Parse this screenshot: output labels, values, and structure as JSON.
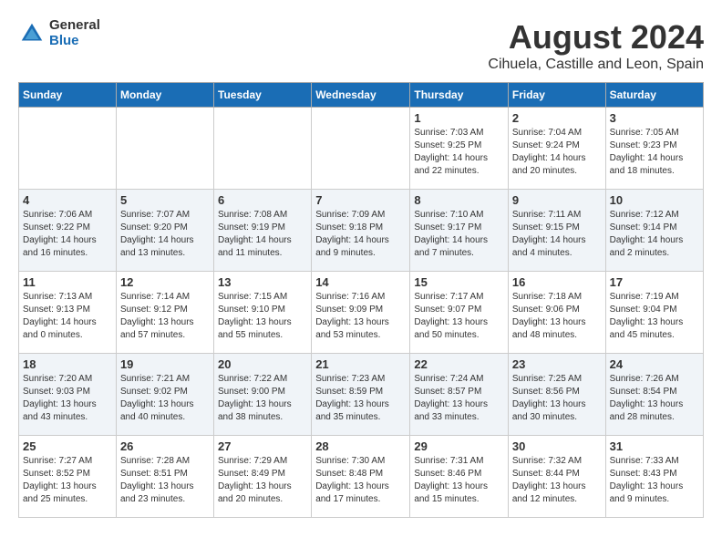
{
  "header": {
    "logo": {
      "general": "General",
      "blue": "Blue"
    },
    "title": "August 2024",
    "subtitle": "Cihuela, Castille and Leon, Spain"
  },
  "weekdays": [
    "Sunday",
    "Monday",
    "Tuesday",
    "Wednesday",
    "Thursday",
    "Friday",
    "Saturday"
  ],
  "weeks": [
    [
      {
        "day": "",
        "sunrise": "",
        "sunset": "",
        "daylight": ""
      },
      {
        "day": "",
        "sunrise": "",
        "sunset": "",
        "daylight": ""
      },
      {
        "day": "",
        "sunrise": "",
        "sunset": "",
        "daylight": ""
      },
      {
        "day": "",
        "sunrise": "",
        "sunset": "",
        "daylight": ""
      },
      {
        "day": "1",
        "sunrise": "Sunrise: 7:03 AM",
        "sunset": "Sunset: 9:25 PM",
        "daylight": "Daylight: 14 hours and 22 minutes."
      },
      {
        "day": "2",
        "sunrise": "Sunrise: 7:04 AM",
        "sunset": "Sunset: 9:24 PM",
        "daylight": "Daylight: 14 hours and 20 minutes."
      },
      {
        "day": "3",
        "sunrise": "Sunrise: 7:05 AM",
        "sunset": "Sunset: 9:23 PM",
        "daylight": "Daylight: 14 hours and 18 minutes."
      }
    ],
    [
      {
        "day": "4",
        "sunrise": "Sunrise: 7:06 AM",
        "sunset": "Sunset: 9:22 PM",
        "daylight": "Daylight: 14 hours and 16 minutes."
      },
      {
        "day": "5",
        "sunrise": "Sunrise: 7:07 AM",
        "sunset": "Sunset: 9:20 PM",
        "daylight": "Daylight: 14 hours and 13 minutes."
      },
      {
        "day": "6",
        "sunrise": "Sunrise: 7:08 AM",
        "sunset": "Sunset: 9:19 PM",
        "daylight": "Daylight: 14 hours and 11 minutes."
      },
      {
        "day": "7",
        "sunrise": "Sunrise: 7:09 AM",
        "sunset": "Sunset: 9:18 PM",
        "daylight": "Daylight: 14 hours and 9 minutes."
      },
      {
        "day": "8",
        "sunrise": "Sunrise: 7:10 AM",
        "sunset": "Sunset: 9:17 PM",
        "daylight": "Daylight: 14 hours and 7 minutes."
      },
      {
        "day": "9",
        "sunrise": "Sunrise: 7:11 AM",
        "sunset": "Sunset: 9:15 PM",
        "daylight": "Daylight: 14 hours and 4 minutes."
      },
      {
        "day": "10",
        "sunrise": "Sunrise: 7:12 AM",
        "sunset": "Sunset: 9:14 PM",
        "daylight": "Daylight: 14 hours and 2 minutes."
      }
    ],
    [
      {
        "day": "11",
        "sunrise": "Sunrise: 7:13 AM",
        "sunset": "Sunset: 9:13 PM",
        "daylight": "Daylight: 14 hours and 0 minutes."
      },
      {
        "day": "12",
        "sunrise": "Sunrise: 7:14 AM",
        "sunset": "Sunset: 9:12 PM",
        "daylight": "Daylight: 13 hours and 57 minutes."
      },
      {
        "day": "13",
        "sunrise": "Sunrise: 7:15 AM",
        "sunset": "Sunset: 9:10 PM",
        "daylight": "Daylight: 13 hours and 55 minutes."
      },
      {
        "day": "14",
        "sunrise": "Sunrise: 7:16 AM",
        "sunset": "Sunset: 9:09 PM",
        "daylight": "Daylight: 13 hours and 53 minutes."
      },
      {
        "day": "15",
        "sunrise": "Sunrise: 7:17 AM",
        "sunset": "Sunset: 9:07 PM",
        "daylight": "Daylight: 13 hours and 50 minutes."
      },
      {
        "day": "16",
        "sunrise": "Sunrise: 7:18 AM",
        "sunset": "Sunset: 9:06 PM",
        "daylight": "Daylight: 13 hours and 48 minutes."
      },
      {
        "day": "17",
        "sunrise": "Sunrise: 7:19 AM",
        "sunset": "Sunset: 9:04 PM",
        "daylight": "Daylight: 13 hours and 45 minutes."
      }
    ],
    [
      {
        "day": "18",
        "sunrise": "Sunrise: 7:20 AM",
        "sunset": "Sunset: 9:03 PM",
        "daylight": "Daylight: 13 hours and 43 minutes."
      },
      {
        "day": "19",
        "sunrise": "Sunrise: 7:21 AM",
        "sunset": "Sunset: 9:02 PM",
        "daylight": "Daylight: 13 hours and 40 minutes."
      },
      {
        "day": "20",
        "sunrise": "Sunrise: 7:22 AM",
        "sunset": "Sunset: 9:00 PM",
        "daylight": "Daylight: 13 hours and 38 minutes."
      },
      {
        "day": "21",
        "sunrise": "Sunrise: 7:23 AM",
        "sunset": "Sunset: 8:59 PM",
        "daylight": "Daylight: 13 hours and 35 minutes."
      },
      {
        "day": "22",
        "sunrise": "Sunrise: 7:24 AM",
        "sunset": "Sunset: 8:57 PM",
        "daylight": "Daylight: 13 hours and 33 minutes."
      },
      {
        "day": "23",
        "sunrise": "Sunrise: 7:25 AM",
        "sunset": "Sunset: 8:56 PM",
        "daylight": "Daylight: 13 hours and 30 minutes."
      },
      {
        "day": "24",
        "sunrise": "Sunrise: 7:26 AM",
        "sunset": "Sunset: 8:54 PM",
        "daylight": "Daylight: 13 hours and 28 minutes."
      }
    ],
    [
      {
        "day": "25",
        "sunrise": "Sunrise: 7:27 AM",
        "sunset": "Sunset: 8:52 PM",
        "daylight": "Daylight: 13 hours and 25 minutes."
      },
      {
        "day": "26",
        "sunrise": "Sunrise: 7:28 AM",
        "sunset": "Sunset: 8:51 PM",
        "daylight": "Daylight: 13 hours and 23 minutes."
      },
      {
        "day": "27",
        "sunrise": "Sunrise: 7:29 AM",
        "sunset": "Sunset: 8:49 PM",
        "daylight": "Daylight: 13 hours and 20 minutes."
      },
      {
        "day": "28",
        "sunrise": "Sunrise: 7:30 AM",
        "sunset": "Sunset: 8:48 PM",
        "daylight": "Daylight: 13 hours and 17 minutes."
      },
      {
        "day": "29",
        "sunrise": "Sunrise: 7:31 AM",
        "sunset": "Sunset: 8:46 PM",
        "daylight": "Daylight: 13 hours and 15 minutes."
      },
      {
        "day": "30",
        "sunrise": "Sunrise: 7:32 AM",
        "sunset": "Sunset: 8:44 PM",
        "daylight": "Daylight: 13 hours and 12 minutes."
      },
      {
        "day": "31",
        "sunrise": "Sunrise: 7:33 AM",
        "sunset": "Sunset: 8:43 PM",
        "daylight": "Daylight: 13 hours and 9 minutes."
      }
    ]
  ]
}
